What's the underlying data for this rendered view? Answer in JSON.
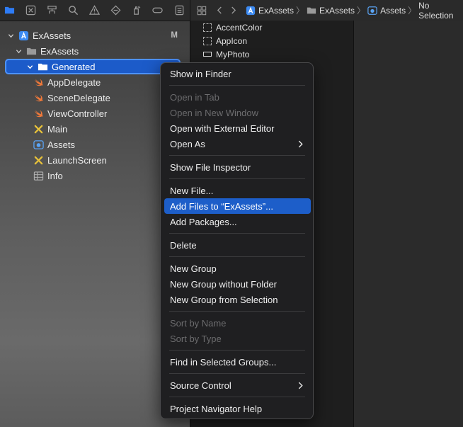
{
  "navigator": {
    "toolbar_icons": [
      "folder-icon",
      "source-control-icon",
      "hierarchy-icon",
      "search-icon",
      "warning-icon",
      "test-diamond-icon",
      "debug-spray-icon",
      "breakpoint-icon",
      "report-icon"
    ],
    "tree": [
      {
        "label": "ExAssets",
        "badge": "M",
        "icon": "project-icon"
      },
      {
        "label": "ExAssets",
        "icon": "folder-icon"
      },
      {
        "label": "Generated",
        "icon": "folder-icon",
        "selected": true
      },
      {
        "label": "AppDelegate",
        "icon": "swift-icon"
      },
      {
        "label": "SceneDelegate",
        "icon": "swift-icon"
      },
      {
        "label": "ViewController",
        "icon": "swift-icon"
      },
      {
        "label": "Main",
        "icon": "storyboard-icon"
      },
      {
        "label": "Assets",
        "icon": "asset-catalog-icon"
      },
      {
        "label": "LaunchScreen",
        "icon": "storyboard-icon"
      },
      {
        "label": "Info",
        "icon": "plist-icon"
      }
    ]
  },
  "jump_bar": {
    "crumbs": [
      "ExAssets",
      "ExAssets",
      "Assets",
      "No Selection"
    ]
  },
  "assets": [
    "AccentColor",
    "AppIcon",
    "MyPhoto"
  ],
  "context_menu": {
    "items": [
      "Show in Finder",
      "Open in Tab",
      "Open in New Window",
      "Open with External Editor",
      "Open As",
      "Show File Inspector",
      "New File...",
      "Add Files to “ExAssets”...",
      "Add Packages...",
      "Delete",
      "New Group",
      "New Group without Folder",
      "New Group from Selection",
      "Sort by Name",
      "Sort by Type",
      "Find in Selected Groups...",
      "Source Control",
      "Project Navigator Help"
    ]
  },
  "colors": {
    "accent": "#1d5ec9",
    "swift": "#f0793a",
    "storyboard": "#e8c23a",
    "project": "#3d8bf2"
  }
}
